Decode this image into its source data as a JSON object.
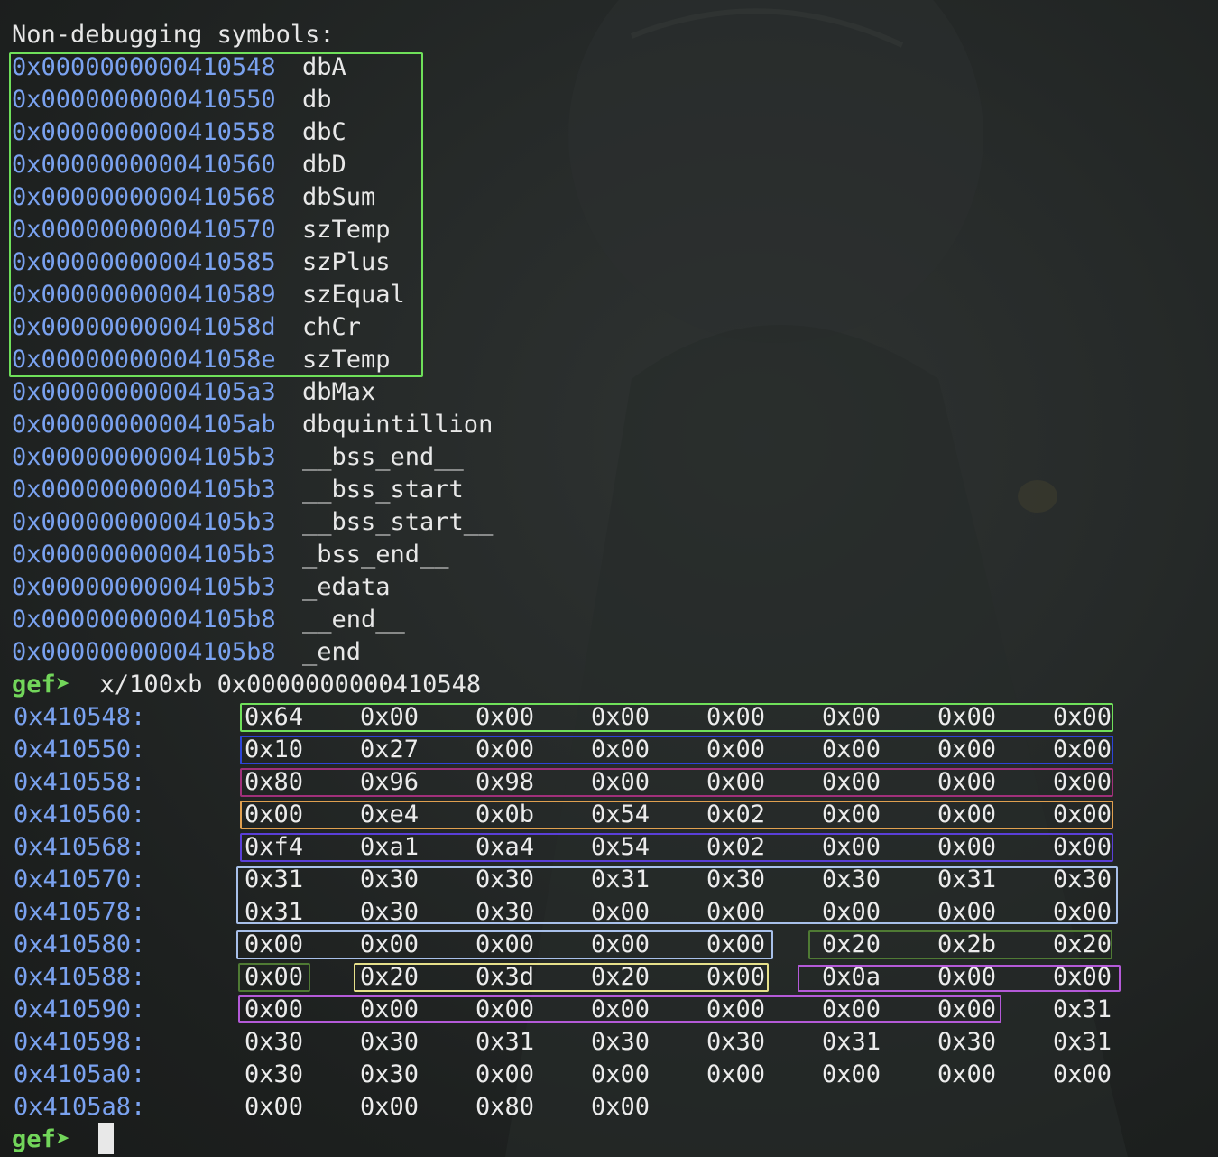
{
  "header": "Non-debugging symbols:",
  "symbols": [
    {
      "addr": "0x0000000000410548",
      "name": "dbA"
    },
    {
      "addr": "0x0000000000410550",
      "name": "db"
    },
    {
      "addr": "0x0000000000410558",
      "name": "dbC"
    },
    {
      "addr": "0x0000000000410560",
      "name": "dbD"
    },
    {
      "addr": "0x0000000000410568",
      "name": "dbSum"
    },
    {
      "addr": "0x0000000000410570",
      "name": "szTemp"
    },
    {
      "addr": "0x0000000000410585",
      "name": "szPlus"
    },
    {
      "addr": "0x0000000000410589",
      "name": "szEqual"
    },
    {
      "addr": "0x000000000041058d",
      "name": "chCr"
    },
    {
      "addr": "0x000000000041058e",
      "name": "szTemp"
    },
    {
      "addr": "0x00000000004105a3",
      "name": "dbMax"
    },
    {
      "addr": "0x00000000004105ab",
      "name": "dbquintillion"
    },
    {
      "addr": "0x00000000004105b3",
      "name": "__bss_end__"
    },
    {
      "addr": "0x00000000004105b3",
      "name": "__bss_start"
    },
    {
      "addr": "0x00000000004105b3",
      "name": "__bss_start__"
    },
    {
      "addr": "0x00000000004105b3",
      "name": "_bss_end__"
    },
    {
      "addr": "0x00000000004105b3",
      "name": "_edata"
    },
    {
      "addr": "0x00000000004105b8",
      "name": "__end__"
    },
    {
      "addr": "0x00000000004105b8",
      "name": "_end"
    }
  ],
  "prompt": "gef➤",
  "command": "x/100xb 0x0000000000410548",
  "memory": [
    {
      "addr": "0x410548:",
      "bytes": [
        "0x64",
        "0x00",
        "0x00",
        "0x00",
        "0x00",
        "0x00",
        "0x00",
        "0x00"
      ]
    },
    {
      "addr": "0x410550:",
      "bytes": [
        "0x10",
        "0x27",
        "0x00",
        "0x00",
        "0x00",
        "0x00",
        "0x00",
        "0x00"
      ]
    },
    {
      "addr": "0x410558:",
      "bytes": [
        "0x80",
        "0x96",
        "0x98",
        "0x00",
        "0x00",
        "0x00",
        "0x00",
        "0x00"
      ]
    },
    {
      "addr": "0x410560:",
      "bytes": [
        "0x00",
        "0xe4",
        "0x0b",
        "0x54",
        "0x02",
        "0x00",
        "0x00",
        "0x00"
      ]
    },
    {
      "addr": "0x410568:",
      "bytes": [
        "0xf4",
        "0xa1",
        "0xa4",
        "0x54",
        "0x02",
        "0x00",
        "0x00",
        "0x00"
      ]
    },
    {
      "addr": "0x410570:",
      "bytes": [
        "0x31",
        "0x30",
        "0x30",
        "0x31",
        "0x30",
        "0x30",
        "0x31",
        "0x30"
      ]
    },
    {
      "addr": "0x410578:",
      "bytes": [
        "0x31",
        "0x30",
        "0x30",
        "0x00",
        "0x00",
        "0x00",
        "0x00",
        "0x00"
      ]
    },
    {
      "addr": "0x410580:",
      "bytes": [
        "0x00",
        "0x00",
        "0x00",
        "0x00",
        "0x00",
        "0x20",
        "0x2b",
        "0x20"
      ]
    },
    {
      "addr": "0x410588:",
      "bytes": [
        "0x00",
        "0x20",
        "0x3d",
        "0x20",
        "0x00",
        "0x0a",
        "0x00",
        "0x00"
      ]
    },
    {
      "addr": "0x410590:",
      "bytes": [
        "0x00",
        "0x00",
        "0x00",
        "0x00",
        "0x00",
        "0x00",
        "0x00",
        "0x31"
      ]
    },
    {
      "addr": "0x410598:",
      "bytes": [
        "0x30",
        "0x30",
        "0x31",
        "0x30",
        "0x30",
        "0x31",
        "0x30",
        "0x31"
      ]
    },
    {
      "addr": "0x4105a0:",
      "bytes": [
        "0x30",
        "0x30",
        "0x00",
        "0x00",
        "0x00",
        "0x00",
        "0x00",
        "0x00"
      ]
    },
    {
      "addr": "0x4105a8:",
      "bytes": [
        "0x00",
        "0x00",
        "0x80",
        "0x00"
      ]
    }
  ],
  "highlight_colors": {
    "green": "#6fe05a",
    "blue": "#2d44d8",
    "magenta": "#a0307a",
    "orange": "#e0a050",
    "indigo": "#5a3fd8",
    "lightblue": "#a8c0ea",
    "olive": "#4f7a34",
    "yellow": "#e6e08a",
    "purple": "#b45ad8"
  },
  "cursor_icon": "block-cursor"
}
